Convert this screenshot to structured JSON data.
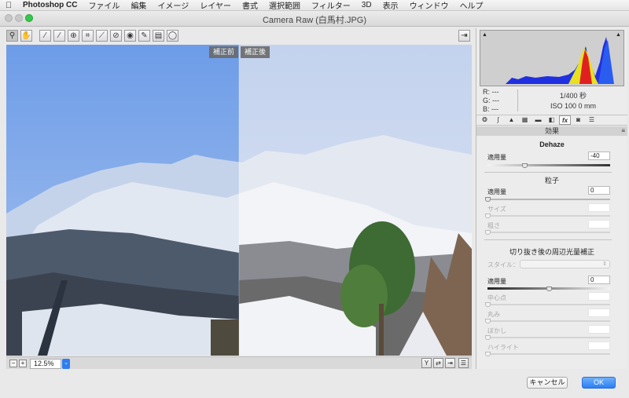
{
  "menubar": {
    "apple_icon": "apple-logo-icon",
    "app_name": "Photoshop CC",
    "items": [
      "ファイル",
      "編集",
      "イメージ",
      "レイヤー",
      "書式",
      "選択範囲",
      "フィルター",
      "3D",
      "表示",
      "ウィンドウ",
      "ヘルプ"
    ]
  },
  "window": {
    "title": "Camera Raw (白馬村.JPG)"
  },
  "toolbar": {
    "tools": [
      {
        "name": "zoom-tool",
        "icon": "magnifier-icon",
        "glyph": "⚲"
      },
      {
        "name": "hand-tool",
        "icon": "hand-icon",
        "glyph": "✋"
      },
      {
        "name": "white-balance-tool",
        "icon": "eyedropper-icon",
        "glyph": "⁄"
      },
      {
        "name": "color-sampler-tool",
        "icon": "color-sampler-icon",
        "glyph": "⁄"
      },
      {
        "name": "targeted-adjustment-tool",
        "icon": "target-adjust-icon",
        "glyph": "⊕"
      },
      {
        "name": "crop-tool",
        "icon": "crop-icon",
        "glyph": "⌗"
      },
      {
        "name": "straighten-tool",
        "icon": "straighten-icon",
        "glyph": "⟋"
      },
      {
        "name": "spot-removal-tool",
        "icon": "spot-removal-icon",
        "glyph": "⊘"
      },
      {
        "name": "red-eye-tool",
        "icon": "red-eye-icon",
        "glyph": "◉"
      },
      {
        "name": "adjustment-brush-tool",
        "icon": "brush-icon",
        "glyph": "✎"
      },
      {
        "name": "graduated-filter-tool",
        "icon": "graduated-filter-icon",
        "glyph": "▤"
      },
      {
        "name": "radial-filter-tool",
        "icon": "radial-filter-icon",
        "glyph": "◯"
      }
    ],
    "open_prefs_icon": "open-preferences-icon"
  },
  "preview": {
    "before_label": "補正前",
    "after_label": "補正後"
  },
  "zoom": {
    "value": "12.5%",
    "minus_icon": "zoom-out-icon",
    "plus_icon": "zoom-in-icon",
    "dropdown_icon": "chevron-down-icon",
    "view_icons": [
      "before-after-y-icon",
      "swap-icon",
      "copy-settings-icon",
      "toggle-settings-icon"
    ]
  },
  "histogram": {
    "clip_shadow_icon": "shadow-clipping-icon",
    "clip_highlight_icon": "highlight-clipping-icon"
  },
  "info": {
    "r": "R:   ---",
    "g": "G:   ---",
    "b": "B:   ---",
    "shutter": "1/400 秒",
    "iso_focal": "ISO 100    0 mm"
  },
  "panel_tabs": [
    {
      "name": "tab-basic",
      "icon": "aperture-icon",
      "glyph": "❂"
    },
    {
      "name": "tab-tone-curve",
      "icon": "curve-icon",
      "glyph": "∫"
    },
    {
      "name": "tab-detail",
      "icon": "detail-icon",
      "glyph": "▲"
    },
    {
      "name": "tab-hsl",
      "icon": "hsl-icon",
      "glyph": "▦"
    },
    {
      "name": "tab-split-toning",
      "icon": "split-tone-icon",
      "glyph": "▬"
    },
    {
      "name": "tab-lens",
      "icon": "lens-icon",
      "glyph": "◧"
    },
    {
      "name": "tab-effects",
      "icon": "fx-icon",
      "glyph": "fx"
    },
    {
      "name": "tab-camera",
      "icon": "camera-icon",
      "glyph": "◙"
    },
    {
      "name": "tab-presets",
      "icon": "presets-icon",
      "glyph": "☰"
    }
  ],
  "effects": {
    "section_title": "効果",
    "menu_icon": "panel-menu-icon",
    "dehaze": {
      "title": "Dehaze",
      "amount_label": "適用量",
      "amount_value": "-40",
      "amount_fraction": 0.3
    },
    "grain": {
      "title": "粒子",
      "amount_label": "適用量",
      "amount_value": "0",
      "size_label": "サイズ",
      "roughness_label": "粗さ"
    },
    "vignette": {
      "title": "切り抜き後の周辺光量補正",
      "style_label": "スタイル：",
      "amount_label": "適用量",
      "amount_value": "0",
      "amount_fraction": 0.5,
      "midpoint_label": "中心点",
      "roundness_label": "丸み",
      "feather_label": "ぼかし",
      "highlights_label": "ハイライト"
    }
  },
  "buttons": {
    "cancel": "キャンセル",
    "ok": "OK"
  },
  "colors": {
    "accent": "#2b7ef3",
    "sky_before": "#7aa6ea",
    "sky_after": "#c9d6ec"
  }
}
